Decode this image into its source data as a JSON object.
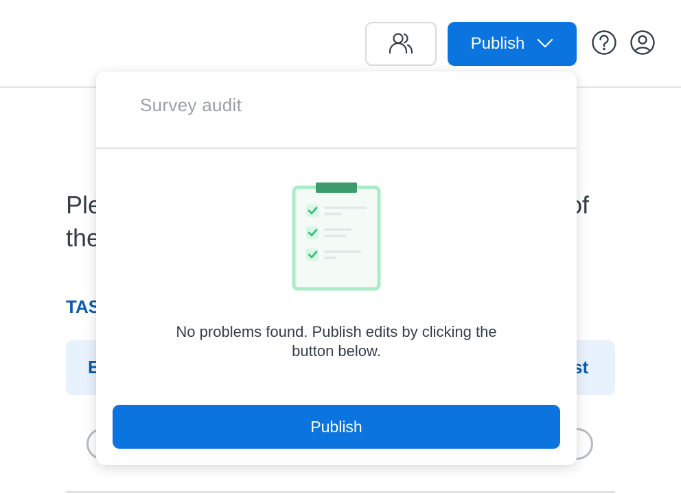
{
  "header": {
    "publish_label": "Publish",
    "collaborators_icon": "people-icon",
    "dropdown_icon": "chevron-down-icon",
    "help_icon": "question-circle-icon",
    "account_icon": "user-circle-icon"
  },
  "background": {
    "line1_start": "Ple",
    "line1_end": "of",
    "line2_start": "the",
    "tasks_partial": "TAS",
    "card_left_partial": "E",
    "card_right_partial": "st"
  },
  "survey_audit": {
    "title": "Survey audit",
    "illustration": "checklist-clipboard-icon",
    "message": "No problems found. Publish edits by clicking the button below.",
    "publish_label": "Publish"
  },
  "colors": {
    "primary": "#0b74de",
    "link_text": "#0b5cad",
    "check_green": "#2fbf71",
    "clipboard_clip": "#3d9a6b"
  }
}
